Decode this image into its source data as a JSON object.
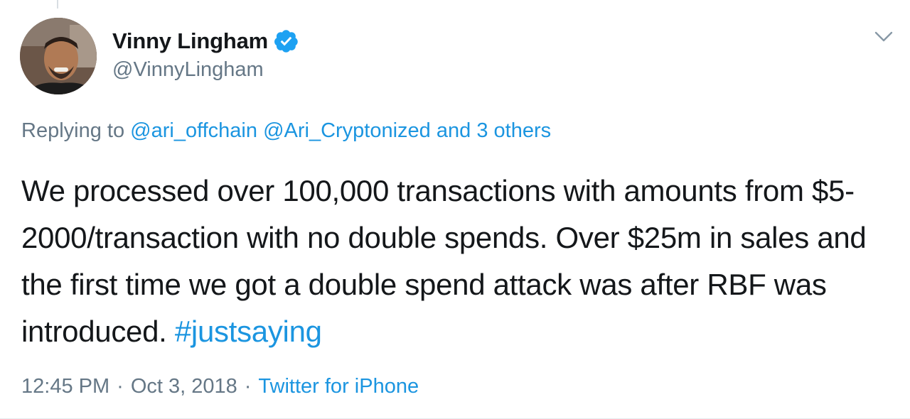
{
  "author": {
    "display_name": "Vinny Lingham",
    "handle": "@VinnyLingham",
    "verified_icon": "verified-badge-icon",
    "avatar": "avatar-photo"
  },
  "menu_icon": "chevron-down-icon",
  "reply_context": {
    "prefix": "Replying to ",
    "mention_1": "@ari_offchain",
    "mention_2": "@Ari_Cryptonized",
    "others": "and 3 others"
  },
  "tweet": {
    "text": "We processed over 100,000 transactions with amounts from $5-2000/transaction with no double spends. Over $25m in sales and the first time we got a double spend attack was after RBF was introduced. ",
    "hashtag": "#justsaying"
  },
  "meta": {
    "time": "12:45 PM",
    "separator": "·",
    "date": "Oct 3, 2018",
    "source": "Twitter for iPhone"
  },
  "colors": {
    "link": "#1b95e0",
    "secondary_text": "#657786",
    "primary_text": "#14171a",
    "verified": "#1da1f2"
  }
}
